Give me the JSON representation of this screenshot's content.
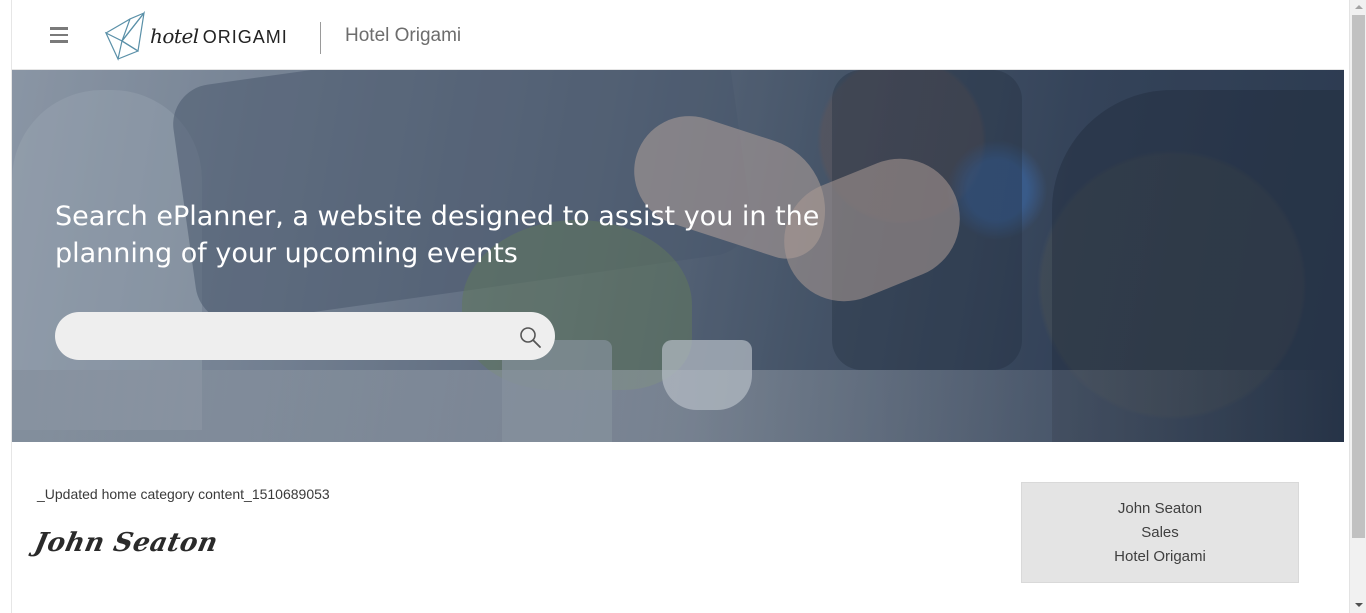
{
  "header": {
    "menu_icon": "hamburger-icon",
    "logo_word_hotel": "hotel",
    "logo_word_origami": "ORIGAMI",
    "title": "Hotel Origami"
  },
  "hero": {
    "heading": "Search ePlanner, a website designed to assist you in the planning of your upcoming events",
    "search": {
      "value": "",
      "placeholder": "",
      "icon": "search-icon"
    }
  },
  "content": {
    "text": "_Updated home category content_1510689053",
    "signature": "John Seaton"
  },
  "card": {
    "name": "John Seaton",
    "department": "Sales",
    "company": "Hotel Origami"
  },
  "colors": {
    "accent": "#5a90a8",
    "card_bg": "#e4e4e4"
  }
}
